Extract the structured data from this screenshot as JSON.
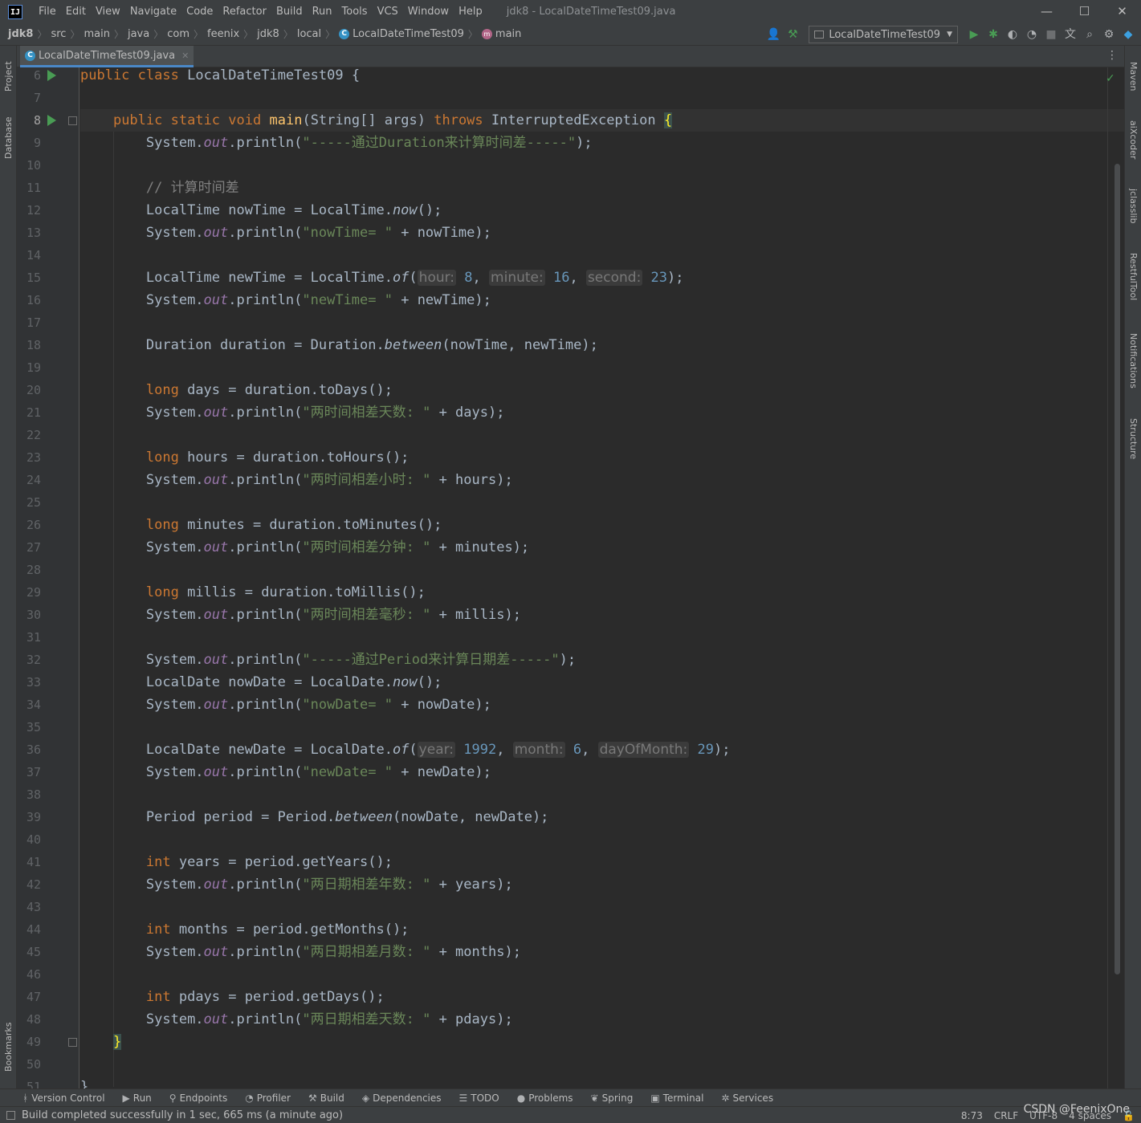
{
  "app": {
    "logo_text": "IJ",
    "title": "jdk8 - LocalDateTimeTest09.java",
    "menus": [
      "File",
      "Edit",
      "View",
      "Navigate",
      "Code",
      "Refactor",
      "Build",
      "Run",
      "Tools",
      "VCS",
      "Window",
      "Help"
    ]
  },
  "window_controls": {
    "minimize": "—",
    "maximize": "☐",
    "close": "✕"
  },
  "breadcrumbs": [
    "jdk8",
    "src",
    "main",
    "java",
    "com",
    "feenix",
    "jdk8",
    "local",
    "LocalDateTimeTest09",
    "main"
  ],
  "run_config": {
    "label": "LocalDateTimeTest09"
  },
  "toolbar_icons": [
    "user-icon",
    "hammer-icon",
    "run-icon",
    "debug-icon",
    "coverage-icon",
    "profile-icon",
    "stop-icon",
    "translate-icon",
    "search-icon",
    "settings-icon",
    "plugin-icon"
  ],
  "editor": {
    "file_tab": "LocalDateTimeTest09.java",
    "tab_close": "✕",
    "line_numbers": [
      "6",
      "7",
      "8",
      "9",
      "10",
      "11",
      "12",
      "13",
      "14",
      "15",
      "16",
      "17",
      "18",
      "19",
      "20",
      "21",
      "22",
      "23",
      "24",
      "25",
      "26",
      "27",
      "28",
      "29",
      "30",
      "31",
      "32",
      "33",
      "34",
      "35",
      "36",
      "37",
      "38",
      "39",
      "40",
      "41",
      "42",
      "43",
      "44",
      "45",
      "46",
      "47",
      "48",
      "49",
      "50",
      "51"
    ],
    "code": {
      "kw_public": "public",
      "kw_class": "class",
      "kw_static": "static",
      "kw_void": "void",
      "kw_throws": "throws",
      "kw_long": "long",
      "kw_int": "int",
      "class_name": "LocalDateTimeTest09",
      "method_main": "main",
      "main_params": "(String[] args)",
      "exception": "InterruptedException",
      "open_brace": "{",
      "close_brace": "}",
      "system": "System.",
      "out": "out",
      "println": ".println(",
      "str_duration_header": "\"-----通过Duration来计算时间差-----\"",
      "comment_calc": "// 计算时间差",
      "nowtime_decl": "LocalTime nowTime = LocalTime.",
      "now": "now",
      "call_end": "();",
      "str_nowtime": "\"nowTime= \"",
      "plus_nowtime": " + nowTime);",
      "newtime_decl": "LocalTime newTime = LocalTime.",
      "of": "of",
      "hint_hour": "hour:",
      "val_hour": "8",
      "hint_minute": "minute:",
      "val_minute": "16",
      "hint_second": "second:",
      "val_second": "23",
      "str_newtime": "\"newTime= \"",
      "plus_newtime": " + newTime);",
      "duration_decl": "Duration duration = Duration.",
      "between": "between",
      "duration_args": "(nowTime, newTime);",
      "days_decl": " days = duration.toDays();",
      "str_days": "\"两时间相差天数: \"",
      "plus_days": " + days);",
      "hours_decl": " hours = duration.toHours();",
      "str_hours": "\"两时间相差小时: \"",
      "plus_hours": " + hours);",
      "minutes_decl": " minutes = duration.toMinutes();",
      "str_minutes": "\"两时间相差分钟: \"",
      "plus_minutes": " + minutes);",
      "millis_decl": " millis = duration.toMillis();",
      "str_millis": "\"两时间相差毫秒: \"",
      "plus_millis": " + millis);",
      "str_period_header": "\"-----通过Period来计算日期差-----\"",
      "close_paren": ");",
      "nowdate_decl": "LocalDate nowDate = LocalDate.",
      "str_nowdate": "\"nowDate= \"",
      "plus_nowdate": " + nowDate);",
      "newdate_decl": "LocalDate newDate = LocalDate.",
      "hint_year": "year:",
      "val_year": "1992",
      "hint_month": "month:",
      "val_month": "6",
      "hint_dom": "dayOfMonth:",
      "val_dom": "29",
      "str_newdate": "\"newDate= \"",
      "plus_newdate": " + newDate);",
      "period_decl": "Period period = Period.",
      "period_args": "(nowDate, newDate);",
      "years_decl": " years = period.getYears();",
      "str_years": "\"两日期相差年数: \"",
      "plus_years": " + years);",
      "months_decl": " months = period.getMonths();",
      "str_months": "\"两日期相差月数: \"",
      "plus_months": " + months);",
      "pdays_decl": " pdays = period.getDays();",
      "str_pdays": "\"两日期相差天数: \"",
      "plus_pdays": " + pdays);"
    }
  },
  "left_tool_windows": [
    "Project",
    "Database",
    "Bookmarks"
  ],
  "right_tool_windows": [
    "Maven",
    "aiXcoder",
    "jclasslib",
    "RestfulTool",
    "Notifications",
    "Structure"
  ],
  "bottom_tabs": [
    "Version Control",
    "Run",
    "Endpoints",
    "Profiler",
    "Build",
    "Dependencies",
    "TODO",
    "Problems",
    "Spring",
    "Terminal",
    "Services"
  ],
  "status": {
    "message": "Build completed successfully in 1 sec, 665 ms (a minute ago)",
    "position": "8:73",
    "line_sep": "CRLF",
    "encoding": "UTF-8",
    "indent": "4 spaces"
  },
  "watermark": "CSDN @FeenixOne"
}
